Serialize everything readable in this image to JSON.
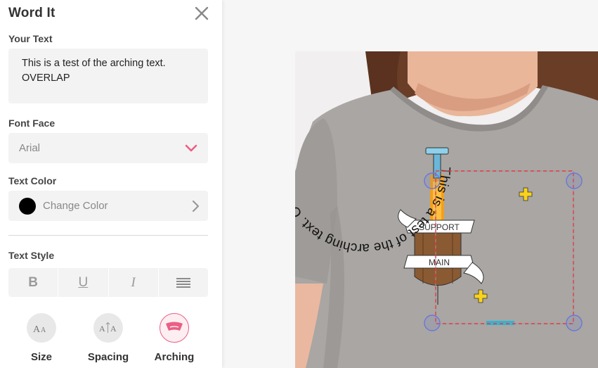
{
  "panel": {
    "title": "Word It",
    "your_text_label": "Your Text",
    "text_value_line1": "This is a test of the arching text.",
    "text_value_line2": "OVERLAP",
    "font_face_label": "Font Face",
    "font_face_value": "Arial",
    "text_color_label": "Text Color",
    "change_color_label": "Change Color",
    "swatch_color": "#000000",
    "text_style_label": "Text Style",
    "style_buttons": [
      "B",
      "U",
      "I",
      "≡"
    ],
    "tools": [
      {
        "label": "Size",
        "glyph": "AA"
      },
      {
        "label": "Spacing",
        "glyph": "A|A"
      },
      {
        "label": "Arching",
        "glyph": "arch"
      }
    ]
  },
  "design": {
    "arched_text": "This is a test of the arching text. OVERLAP",
    "banner_top": "SUPPORT",
    "banner_bottom": "MAIN",
    "accent_color": "#e95f86",
    "selection_color": "#e63946",
    "handle_color": "#6a78d8"
  }
}
